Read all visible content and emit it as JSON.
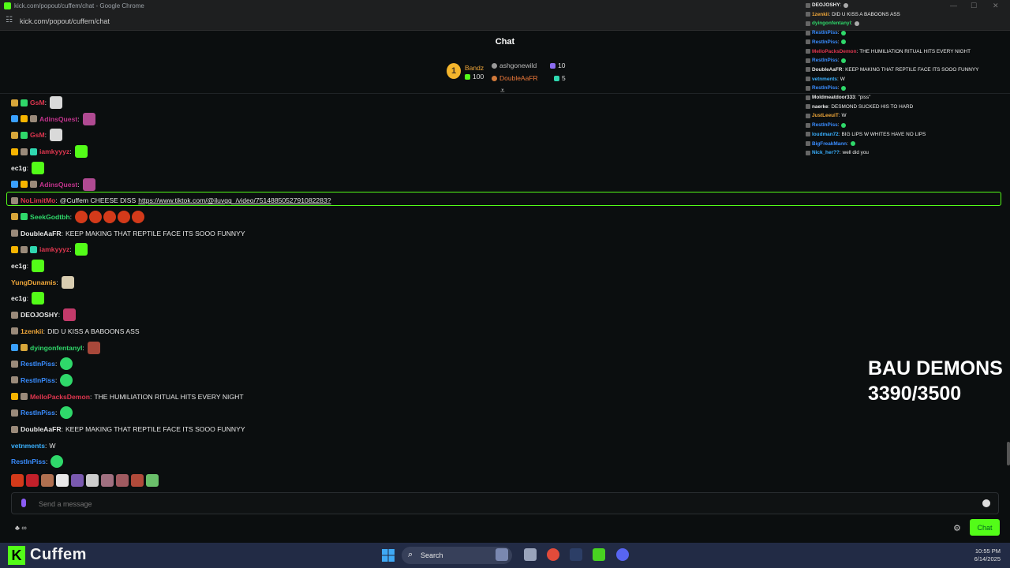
{
  "browser": {
    "title": "kick.com/popout/cuffem/chat - Google Chrome",
    "url": "kick.com/popout/cuffem/chat"
  },
  "chat": {
    "header": "Chat",
    "leaderboard": {
      "first": {
        "rank": "1",
        "name": "Bandz",
        "count": "100"
      },
      "second": {
        "name": "ashgonewild",
        "count": "10"
      },
      "third": {
        "name": "DoubleAaFR",
        "count": "5"
      }
    },
    "messages": [
      {
        "user": "GsM",
        "text": "",
        "color": "#e0364f",
        "badges": [
          "#d8a63a",
          "#2fd86a"
        ],
        "emote": "#d9d9d9"
      },
      {
        "user": "AdinsQuest",
        "text": "",
        "color": "#c2338c",
        "badges": [
          "#3aa0ff",
          "#f5b400",
          "#9a8a7a"
        ],
        "emote": "#b04a92"
      },
      {
        "user": "GsM",
        "text": "",
        "color": "#e0364f",
        "badges": [
          "#d8a63a",
          "#2fd86a"
        ],
        "emote": "#d9d9d9"
      },
      {
        "user": "iamkyyyz",
        "text": "",
        "color": "#e0364f",
        "badges": [
          "#f5b400",
          "#9a8a7a",
          "#2fd8b0"
        ],
        "emote": "#53fc18"
      },
      {
        "user": "ec1g",
        "text": "",
        "color": "#e8e8e8",
        "badges": [],
        "emote": "#53fc18"
      },
      {
        "user": "AdinsQuest",
        "text": "",
        "color": "#c2338c",
        "badges": [
          "#3aa0ff",
          "#f5b400",
          "#9a8a7a"
        ],
        "emote": "#b04a92"
      },
      {
        "user": "NoLimitMo",
        "text": "@Cuffem CHEESE DISS",
        "link": "https://www.tiktok.com/@iluvgg_/video/7514885052791082283?",
        "color": "#e0364f",
        "badges": [
          "#9a8a7a"
        ],
        "emote": ""
      },
      {
        "user": "SeekGodtbh",
        "text": "",
        "color": "#2fd86a",
        "badges": [
          "#d8a63a",
          "#2fd86a"
        ],
        "emote": "#d33a1a"
      },
      {
        "user": "DoubleAaFR",
        "text": "KEEP MAKING THAT REPTILE FACE ITS SOOO FUNNYY",
        "color": "#e8e8e8",
        "badges": [
          "#9a8a7a"
        ],
        "emote": ""
      },
      {
        "user": "iamkyyyz",
        "text": "",
        "color": "#e0364f",
        "badges": [
          "#f5b400",
          "#9a8a7a",
          "#2fd8b0"
        ],
        "emote": "#53fc18"
      },
      {
        "user": "ec1g",
        "text": "",
        "color": "#e8e8e8",
        "badges": [],
        "emote": "#53fc18"
      },
      {
        "user": "YungDunamis",
        "text": "",
        "color": "#f0a73a",
        "badges": [],
        "emote": "#d8ccb0"
      },
      {
        "user": "ec1g",
        "text": "",
        "color": "#e8e8e8",
        "badges": [],
        "emote": "#53fc18"
      },
      {
        "user": "DEOJOSHY",
        "text": "",
        "color": "#e8e8e8",
        "badges": [
          "#9a8a7a"
        ],
        "emote": "#c23a6a"
      },
      {
        "user": "1zenkii",
        "text": "DID U KISS A BABOONS ASS",
        "color": "#f0a73a",
        "badges": [
          "#9a8a7a"
        ],
        "emote": ""
      },
      {
        "user": "dyingonfentanyl",
        "text": "",
        "color": "#2fd86a",
        "badges": [
          "#3aa0ff",
          "#d8a63a"
        ],
        "emote": "#a8483a"
      },
      {
        "user": "RestInPiss",
        "text": "",
        "color": "#3a8dff",
        "badges": [
          "#9a8a7a"
        ],
        "emote": "#2fd86a"
      },
      {
        "user": "RestInPiss",
        "text": "",
        "color": "#3a8dff",
        "badges": [
          "#9a8a7a"
        ],
        "emote": "#2fd86a"
      },
      {
        "user": "MelloPacksDemon",
        "text": "THE HUMILIATION RITUAL HITS EVERY NIGHT",
        "color": "#e0364f",
        "badges": [
          "#f5b400",
          "#9a8a7a"
        ],
        "emote": ""
      },
      {
        "user": "RestInPiss",
        "text": "",
        "color": "#3a8dff",
        "badges": [
          "#9a8a7a"
        ],
        "emote": "#2fd86a"
      },
      {
        "user": "DoubleAaFR",
        "text": "KEEP MAKING THAT REPTILE FACE ITS SOOO FUNNYY",
        "color": "#e8e8e8",
        "badges": [
          "#9a8a7a"
        ],
        "emote": ""
      },
      {
        "user": "vetnments",
        "text": "W",
        "color": "#3ab0ff",
        "badges": [],
        "emote": ""
      },
      {
        "user": "RestInPiss",
        "text": "",
        "color": "#3a8dff",
        "badges": [],
        "emote": "#2fd86a"
      }
    ],
    "emote_bar": [
      "#d33a1a",
      "#c2202a",
      "#b07050",
      "#e8e8e8",
      "#7a5ab0",
      "#cccccc",
      "#a07080",
      "#a05a60",
      "#b04a3a",
      "#6abf6a"
    ],
    "input_placeholder": "Send a message",
    "chat_button": "Chat",
    "bottom_left": "♣ ∞"
  },
  "overlay": {
    "messages": [
      {
        "user": "DEOJOSHY",
        "text": "",
        "color": "#e8e8e8"
      },
      {
        "user": "1zenkii",
        "text": "DID U KISS A BABOONS ASS",
        "color": "#f0a73a"
      },
      {
        "user": "dyingonfentanyl",
        "text": "",
        "color": "#2fd86a"
      },
      {
        "user": "RestInPiss",
        "text": "",
        "color": "#3a8dff"
      },
      {
        "user": "RestInPiss",
        "text": "",
        "color": "#3a8dff"
      },
      {
        "user": "MelloPacksDemon",
        "text": "THE HUMILIATION RITUAL HITS EVERY NIGHT",
        "color": "#e0364f"
      },
      {
        "user": "RestInPiss",
        "text": "",
        "color": "#3a8dff"
      },
      {
        "user": "DoubleAaFR",
        "text": "KEEP MAKING THAT REPTILE FACE ITS SOOO FUNNYY",
        "color": "#e8e8e8"
      },
      {
        "user": "vetnments",
        "text": "W",
        "color": "#3ab0ff"
      },
      {
        "user": "RestInPiss",
        "text": "",
        "color": "#3a8dff"
      },
      {
        "user": "Moldmeatdoor333",
        "text": "\"piss\"",
        "color": "#e8e8e8"
      },
      {
        "user": "naerke",
        "text": "DESMOND SUCKED HIS TO HARD",
        "color": "#e8e8e8"
      },
      {
        "user": "JustLeeuiT",
        "text": "W",
        "color": "#f0a73a"
      },
      {
        "user": "RestInPiss",
        "text": "",
        "color": "#3a8dff"
      },
      {
        "user": "loudman72",
        "text": "BIG LIPS W WHITES HAVE NO LIPS",
        "color": "#3ab0ff"
      },
      {
        "user": "BigFreakMann",
        "text": "",
        "color": "#3a8dff"
      },
      {
        "user": "Nick_her??",
        "text": "well did you",
        "color": "#3ab0ff"
      }
    ]
  },
  "goal": {
    "line1": "BAU DEMONS",
    "line2": "3390/3500"
  },
  "taskbar": {
    "streamer": "Cuffem",
    "search_label": "Search",
    "time": "10:55 PM",
    "date": "6/14/2025"
  }
}
